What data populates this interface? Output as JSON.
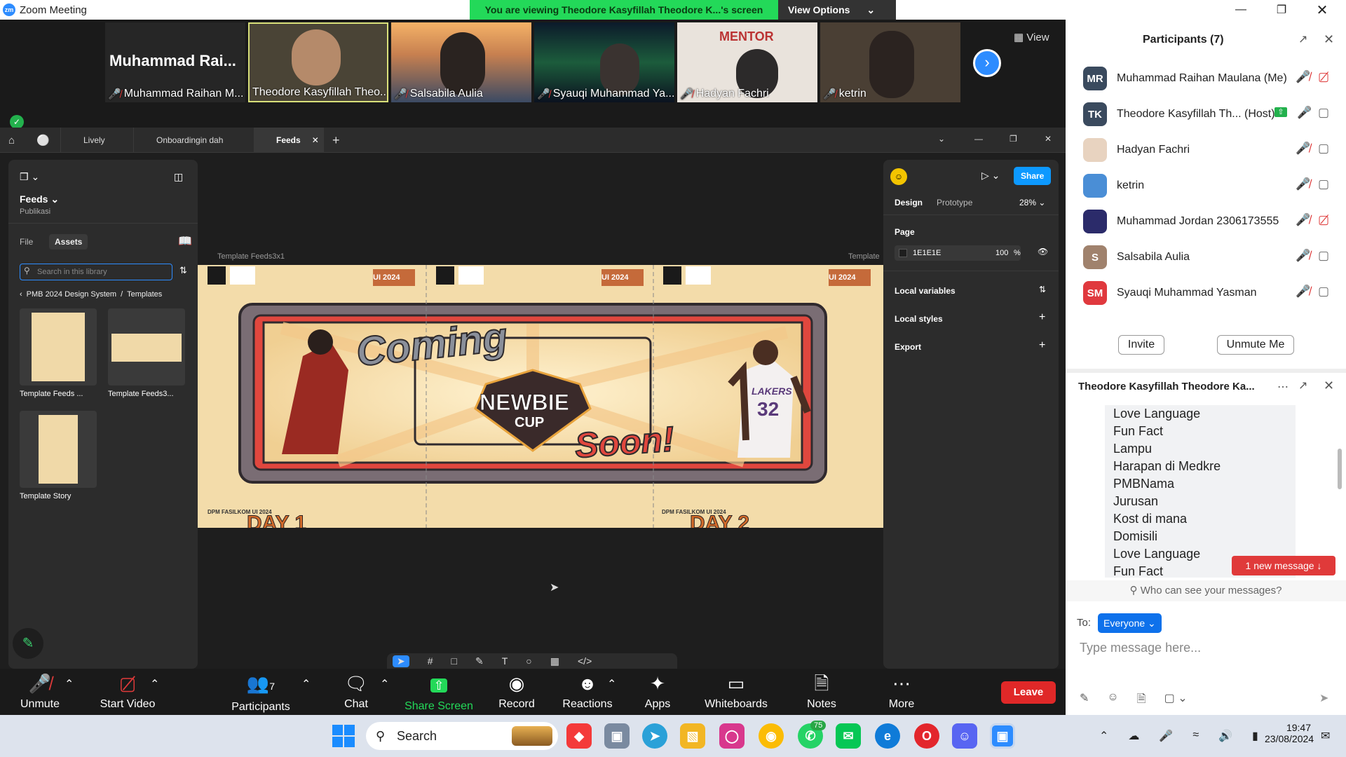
{
  "window": {
    "title": "Zoom Meeting"
  },
  "banner": {
    "text": "You are viewing Theodore Kasyfillah Theodore K...'s screen",
    "view_options": "View Options"
  },
  "strip": {
    "view_label": "View",
    "name_only_tile": "Muhammad  Rai...",
    "tiles": [
      {
        "name": "Muhammad Raihan M..."
      },
      {
        "name": "Theodore Kasyfillah Theo..."
      },
      {
        "name": "Salsabila Aulia"
      },
      {
        "name": "Syauqi Muhammad Ya..."
      },
      {
        "name": "Hadyan Fachri"
      },
      {
        "name": "ketrin"
      }
    ]
  },
  "figma": {
    "tabs": [
      "Lively",
      "Onboardingin dah",
      "Feeds"
    ],
    "file_name": "Feeds",
    "project": "Publikasi",
    "nav_file": "File",
    "nav_assets": "Assets",
    "search_placeholder": "Search in this library",
    "breadcrumb_lib": "PMB 2024 Design System",
    "breadcrumb_sep": "/",
    "breadcrumb_folder": "Templates",
    "templates": [
      "Template Feeds ...",
      "Template Feeds3...",
      "Template Story"
    ],
    "frame_label": "Template Feeds3x1",
    "frame_label_2": "Template",
    "share": "Share",
    "design_tab": "Design",
    "prototype_tab": "Prototype",
    "zoom": "28%",
    "page_heading": "Page",
    "page_color": "1E1E1E",
    "page_opacity": "100",
    "page_opacity_unit": "%",
    "local_variables": "Local variables",
    "local_styles": "Local styles",
    "export": "Export",
    "help": "?",
    "art": {
      "coming": "Coming",
      "newbie": "NEWBIE",
      "cup": "CUP",
      "soon": "Soon!",
      "jersey": "32",
      "team": "LAKERS",
      "badge": "UI 2024",
      "footer": "DPM FASILKOM UI 2024",
      "day1": "DAY 1",
      "day2": "DAY 2",
      "mentor": "MENTOR"
    }
  },
  "toolbar": {
    "unmute": "Unmute",
    "start_video": "Start Video",
    "participants": "Participants",
    "participants_count": "7",
    "chat": "Chat",
    "share_screen": "Share Screen",
    "record": "Record",
    "reactions": "Reactions",
    "apps": "Apps",
    "whiteboards": "Whiteboards",
    "notes": "Notes",
    "more": "More",
    "leave": "Leave"
  },
  "participants": {
    "title": "Participants (7)",
    "list": [
      {
        "initials": "MR",
        "name": "Muhammad Raihan Maulana (Me)",
        "color": "#3a4a5e"
      },
      {
        "initials": "TK",
        "name": "Theodore Kasyfillah Th...  (Host)",
        "color": "#3a4a5e"
      },
      {
        "initials": "",
        "name": "Hadyan Fachri",
        "color": "#e8d3c0"
      },
      {
        "initials": "",
        "name": "ketrin",
        "color": "#4a8ed6"
      },
      {
        "initials": "",
        "name": "Muhammad Jordan 2306173555",
        "color": "#2b2b6a"
      },
      {
        "initials": "S",
        "name": "Salsabila Aulia",
        "color": "#a0826d"
      },
      {
        "initials": "SM",
        "name": "Syauqi Muhammad Yasman",
        "color": "#e0393e"
      }
    ],
    "invite": "Invite",
    "unmute_me": "Unmute Me"
  },
  "chat": {
    "title": "Theodore Kasyfillah Theodore Ka...",
    "lines": [
      "Love Language",
      "Fun Fact",
      "Lampu",
      "Harapan di Medkre",
      "PMBNama",
      "Jurusan",
      "Kost di mana",
      "Domisili",
      "Love Language",
      "Fun Fact"
    ],
    "new_message": "1 new message",
    "who_can_see": "Who can see your messages?",
    "to_label": "To:",
    "to_value": "Everyone",
    "placeholder": "Type message here..."
  },
  "taskbar": {
    "search": "Search",
    "whatsapp_badge": "75",
    "time": "19:47",
    "date": "23/08/2024"
  }
}
